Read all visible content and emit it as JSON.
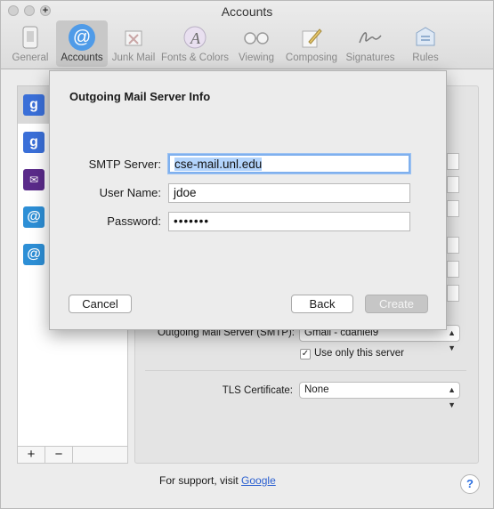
{
  "window": {
    "title": "Accounts",
    "traffic_plus": "+"
  },
  "toolbar": {
    "items": [
      {
        "label": "General",
        "icon": "general-icon"
      },
      {
        "label": "Accounts",
        "icon": "at-icon",
        "glyph": "@"
      },
      {
        "label": "Junk Mail",
        "icon": "junk-mail-icon"
      },
      {
        "label": "Fonts & Colors",
        "icon": "fonts-colors-icon",
        "glyph": "A"
      },
      {
        "label": "Viewing",
        "icon": "glasses-icon"
      },
      {
        "label": "Composing",
        "icon": "pencil-icon"
      },
      {
        "label": "Signatures",
        "icon": "signature-icon"
      },
      {
        "label": "Rules",
        "icon": "rules-icon"
      }
    ]
  },
  "accounts": {
    "rows": [
      {
        "icon": "google-icon",
        "glyph": "g"
      },
      {
        "icon": "google-icon",
        "glyph": "g"
      },
      {
        "icon": "yahoo-mail-icon",
        "glyph": "✉"
      },
      {
        "icon": "at-account-icon",
        "glyph": "@"
      },
      {
        "icon": "at-account-icon",
        "glyph": "@"
      }
    ],
    "add_label": "+",
    "remove_label": "−"
  },
  "details": {
    "smtp_label": "Outgoing Mail Server (SMTP):",
    "smtp_value": "Gmail - cdaniel9",
    "use_only_label": "Use only this server",
    "use_only_checked": "✓",
    "tls_label": "TLS Certificate:",
    "tls_value": "None"
  },
  "support": {
    "text": "For support, visit",
    "link": "Google"
  },
  "help_label": "?",
  "dialog": {
    "title": "Outgoing Mail Server Info",
    "smtp_server_label": "SMTP Server:",
    "smtp_server_value": "cse-mail.unl.edu",
    "user_name_label": "User Name:",
    "user_name_value": "jdoe",
    "password_label": "Password:",
    "password_value": "•••••••",
    "cancel_label": "Cancel",
    "back_label": "Back",
    "create_label": "Create"
  },
  "colors": {
    "accent": "#4f9be8",
    "focus_ring": "#7fb0ee",
    "link": "#2a5fd0"
  }
}
